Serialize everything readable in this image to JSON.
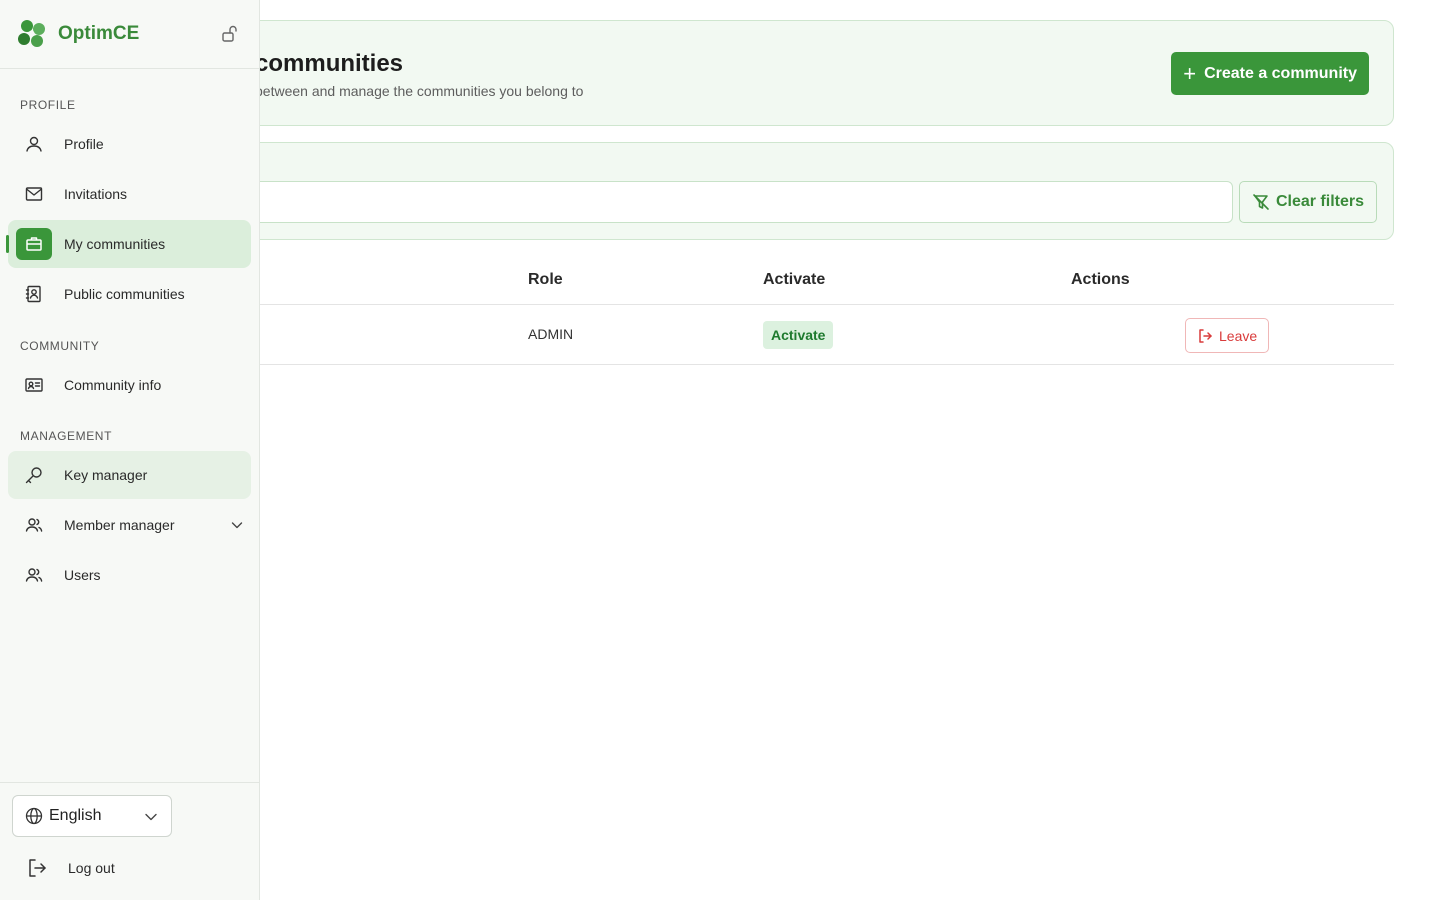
{
  "app": {
    "name": "OptimCE"
  },
  "header": {
    "title": "communities",
    "subtitle": "between and manage the communities you belong to",
    "create_button": "Create a community"
  },
  "filters": {
    "search_placeholder": "",
    "clear_button": "Clear filters"
  },
  "table": {
    "columns": [
      "Role",
      "Activate",
      "Actions"
    ],
    "rows": [
      {
        "role": "ADMIN",
        "activate": "Activate",
        "action": "Leave"
      }
    ]
  },
  "sidebar": {
    "sections": {
      "profile": "PROFILE",
      "community": "COMMUNITY",
      "management": "MANAGEMENT"
    },
    "items": {
      "profile": "Profile",
      "invitations": "Invitations",
      "my_communities": "My communities",
      "public_communities": "Public communities",
      "community_info": "Community info",
      "key_manager": "Key manager",
      "member_manager": "Member manager",
      "users": "Users"
    },
    "language": "English",
    "logout": "Log out"
  },
  "colors": {
    "brand_green": "#3a963a",
    "danger_red": "#d93b3b",
    "badge_bg": "#dcf1df"
  }
}
